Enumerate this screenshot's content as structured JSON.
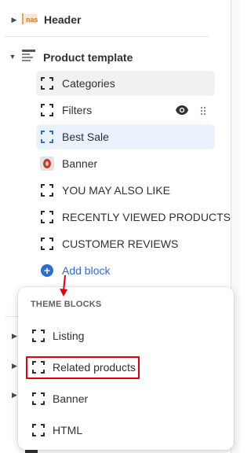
{
  "sections": {
    "header": {
      "label": "Header",
      "icon": "header-section-icon",
      "expanded": false
    },
    "product_template": {
      "label": "Product template",
      "icon": "template-section-icon",
      "expanded": true
    }
  },
  "blocks": [
    {
      "label": "Categories",
      "icon": "block-icon",
      "state": "hover"
    },
    {
      "label": "Filters",
      "icon": "block-icon",
      "state": "normal",
      "visibility_icon": "eye-icon",
      "drag_icon": "drag-handle-icon"
    },
    {
      "label": "Best Sale",
      "icon": "block-icon",
      "state": "active"
    },
    {
      "label": "Banner",
      "icon": "banner-thumbnail-icon",
      "state": "normal"
    },
    {
      "label": "YOU MAY ALSO LIKE",
      "icon": "block-icon",
      "state": "normal"
    },
    {
      "label": "RECENTLY VIEWED PRODUCTS",
      "icon": "block-icon",
      "state": "normal"
    },
    {
      "label": "CUSTOMER REVIEWS",
      "icon": "block-icon",
      "state": "normal"
    }
  ],
  "add_block": {
    "label": "Add block",
    "icon": "plus-circle-icon"
  },
  "popover": {
    "heading": "THEME BLOCKS",
    "items": [
      {
        "label": "Listing",
        "icon": "block-icon"
      },
      {
        "label": "Related products",
        "icon": "block-icon",
        "highlighted": true
      },
      {
        "label": "Banner",
        "icon": "block-icon"
      },
      {
        "label": "HTML",
        "icon": "block-icon"
      }
    ]
  },
  "colors": {
    "accent": "#2c6ecb",
    "annotation_red": "#e0000b",
    "hover_bg": "#f1f1f1",
    "active_bg": "#eaf2fd"
  }
}
